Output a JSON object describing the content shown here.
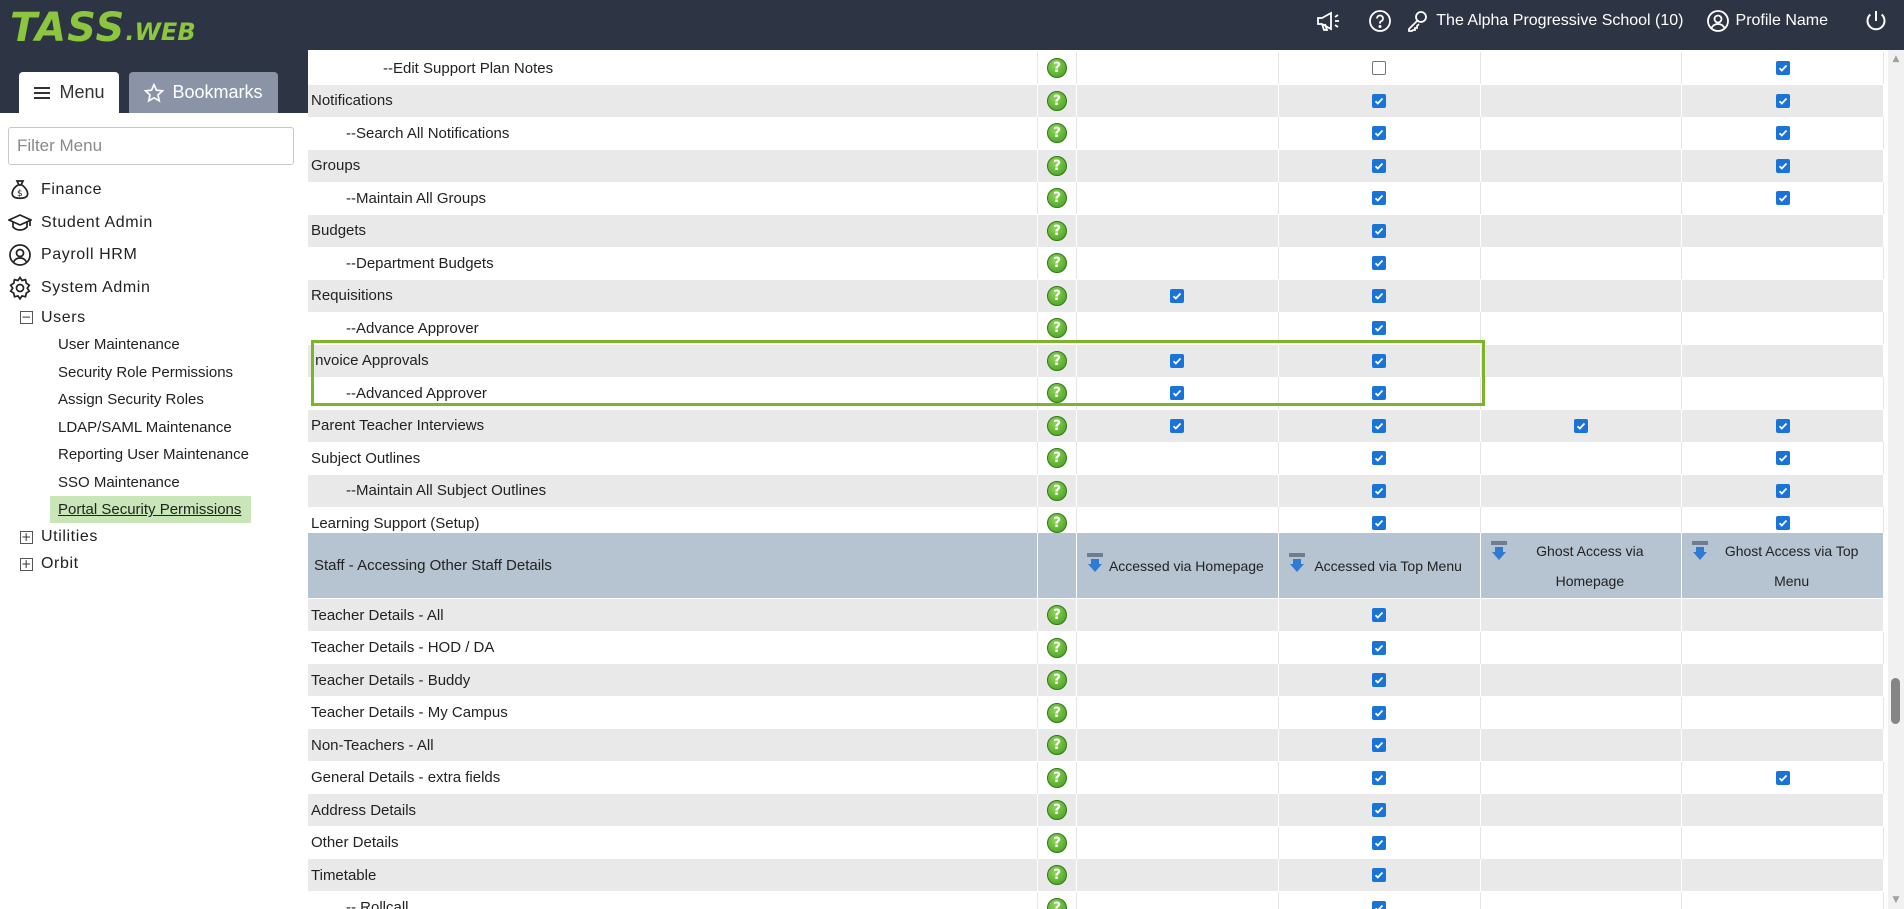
{
  "topbar": {
    "logo_main": "TASS",
    "logo_suffix": ".WEB",
    "school": "The Alpha Progressive School (10)",
    "profile": "Profile Name"
  },
  "sidebar": {
    "tab_menu": "Menu",
    "tab_bookmarks": "Bookmarks",
    "filter_placeholder": "Filter Menu",
    "items": [
      {
        "label": "Finance",
        "icon": "money-bag-icon"
      },
      {
        "label": "Student Admin",
        "icon": "graduation-cap-icon"
      },
      {
        "label": "Payroll HRM",
        "icon": "user-circle-icon"
      },
      {
        "label": "System Admin",
        "icon": "gear-icon"
      }
    ],
    "users_group": "Users",
    "users_items": [
      "User Maintenance",
      "Security Role Permissions",
      "Assign Security Roles",
      "LDAP/SAML Maintenance",
      "Reporting User Maintenance",
      "SSO Maintenance",
      "Portal Security Permissions"
    ],
    "active_item": "Portal Security Permissions",
    "utilities": "Utilities",
    "orbit": "Orbit"
  },
  "table": {
    "rows_top": [
      {
        "name": "--Edit Support Plan Notes",
        "indent": 2,
        "c1": null,
        "c2": false,
        "c3": null,
        "c4": true
      },
      {
        "name": "Notifications",
        "indent": 0,
        "c1": null,
        "c2": true,
        "c3": null,
        "c4": true
      },
      {
        "name": "--Search All Notifications",
        "indent": 1,
        "c1": null,
        "c2": true,
        "c3": null,
        "c4": true
      },
      {
        "name": "Groups",
        "indent": 0,
        "c1": null,
        "c2": true,
        "c3": null,
        "c4": true
      },
      {
        "name": "--Maintain All Groups",
        "indent": 1,
        "c1": null,
        "c2": true,
        "c3": null,
        "c4": true
      },
      {
        "name": "Budgets",
        "indent": 0,
        "c1": null,
        "c2": true,
        "c3": null,
        "c4": null
      },
      {
        "name": "--Department Budgets",
        "indent": 1,
        "c1": null,
        "c2": true,
        "c3": null,
        "c4": null
      },
      {
        "name": "Requisitions",
        "indent": 0,
        "c1": true,
        "c2": true,
        "c3": null,
        "c4": null
      },
      {
        "name": "--Advance Approver",
        "indent": 1,
        "c1": null,
        "c2": true,
        "c3": null,
        "c4": null
      },
      {
        "name": "Invoice Approvals",
        "indent": 0,
        "c1": true,
        "c2": true,
        "c3": null,
        "c4": null
      },
      {
        "name": "--Advanced Approver",
        "indent": 1,
        "c1": true,
        "c2": true,
        "c3": null,
        "c4": null
      },
      {
        "name": "Parent Teacher Interviews",
        "indent": 0,
        "c1": true,
        "c2": true,
        "c3": true,
        "c4": true
      },
      {
        "name": "Subject Outlines",
        "indent": 0,
        "c1": null,
        "c2": true,
        "c3": null,
        "c4": true
      },
      {
        "name": "--Maintain All Subject Outlines",
        "indent": 1,
        "c1": null,
        "c2": true,
        "c3": null,
        "c4": true
      },
      {
        "name": "Learning Support (Setup)",
        "indent": 0,
        "c1": null,
        "c2": true,
        "c3": null,
        "c4": true
      }
    ],
    "section_title": "Staff - Accessing Other Staff Details",
    "columns": [
      "Accessed via Homepage",
      "Accessed via Top Menu",
      "Ghost Access via Homepage",
      "Ghost Access via Top Menu"
    ],
    "rows_bottom": [
      {
        "name": "Teacher Details - All",
        "indent": 0,
        "c1": null,
        "c2": true,
        "c3": null,
        "c4": null
      },
      {
        "name": "Teacher Details - HOD / DA",
        "indent": 0,
        "c1": null,
        "c2": true,
        "c3": null,
        "c4": null
      },
      {
        "name": "Teacher Details - Buddy",
        "indent": 0,
        "c1": null,
        "c2": true,
        "c3": null,
        "c4": null
      },
      {
        "name": "Teacher Details - My Campus",
        "indent": 0,
        "c1": null,
        "c2": true,
        "c3": null,
        "c4": null
      },
      {
        "name": "Non-Teachers - All",
        "indent": 0,
        "c1": null,
        "c2": true,
        "c3": null,
        "c4": null
      },
      {
        "name": "General Details - extra fields",
        "indent": 0,
        "c1": null,
        "c2": true,
        "c3": null,
        "c4": true
      },
      {
        "name": "Address Details",
        "indent": 0,
        "c1": null,
        "c2": true,
        "c3": null,
        "c4": null
      },
      {
        "name": "Other Details",
        "indent": 0,
        "c1": null,
        "c2": true,
        "c3": null,
        "c4": null
      },
      {
        "name": "Timetable",
        "indent": 0,
        "c1": null,
        "c2": true,
        "c3": null,
        "c4": null
      },
      {
        "name": "-- Rollcall",
        "indent": 1,
        "c1": null,
        "c2": true,
        "c3": null,
        "c4": null
      }
    ]
  },
  "colors": {
    "topbar_bg": "#2d3443",
    "accent_green": "#8cc63f",
    "highlight_border": "#7db52a",
    "checkbox_blue": "#1a73d9",
    "header_bg": "#b5c4d0"
  }
}
